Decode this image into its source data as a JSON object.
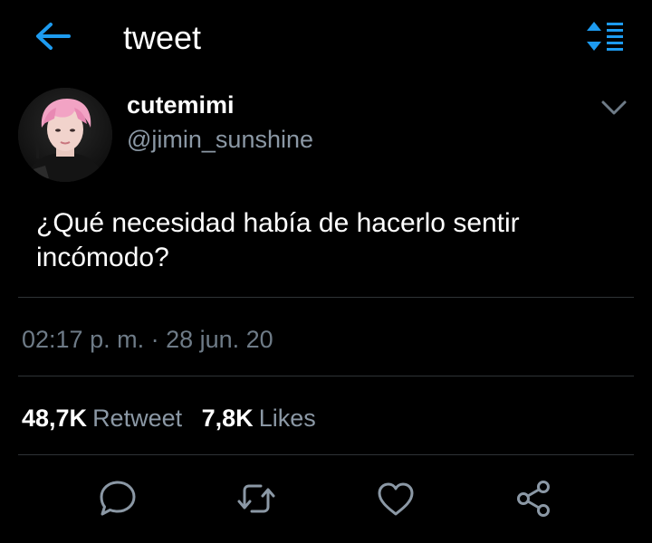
{
  "header": {
    "title": "tweet",
    "back_icon": "arrow-left-icon",
    "sort_icon": "sort-icon",
    "accent_color": "#1d9bf0"
  },
  "tweet": {
    "author": {
      "display_name": "cutemimi",
      "handle": "@jimin_sunshine",
      "avatar": "avatar-photo"
    },
    "text": "¿Qué necesidad había de hacerlo sentir incómodo?",
    "timestamp": "02:17 p. m. · 28 jun. 20",
    "stats": {
      "retweets_count": "48,7K",
      "retweets_label": "Retweet",
      "likes_count": "7,8K",
      "likes_label": "Likes"
    }
  },
  "actions": [
    {
      "name": "reply",
      "icon": "reply-icon"
    },
    {
      "name": "retweet",
      "icon": "retweet-icon"
    },
    {
      "name": "like",
      "icon": "heart-icon"
    },
    {
      "name": "share",
      "icon": "share-icon"
    }
  ],
  "colors": {
    "background": "#000000",
    "text_primary": "#ffffff",
    "text_secondary": "#8b98a5",
    "divider": "#2f3336",
    "icon": "#8b98a5"
  }
}
